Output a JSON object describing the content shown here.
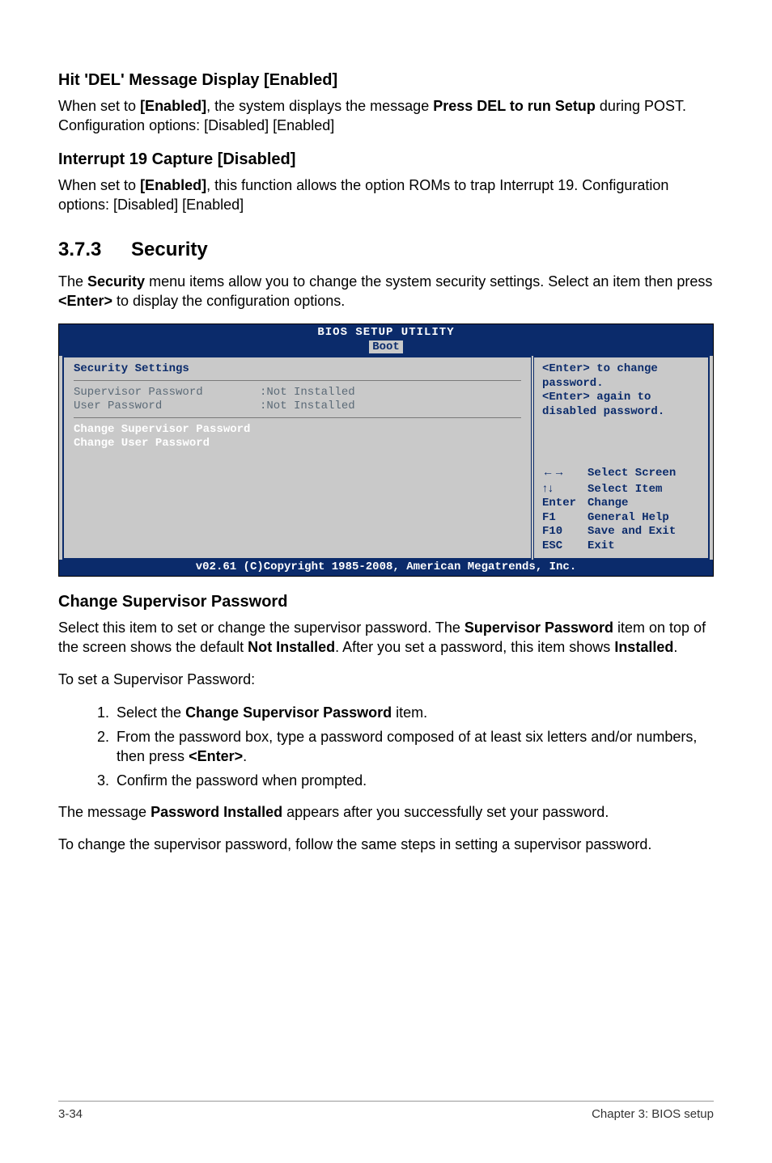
{
  "s1": {
    "heading": "Hit 'DEL' Message Display [Enabled]",
    "p_pre": "When set to ",
    "p_b1": "[Enabled]",
    "p_mid": ", the system displays the message ",
    "p_b2": "Press DEL to run Setup",
    "p_post": " during POST. Configuration options: [Disabled] [Enabled]"
  },
  "s2": {
    "heading": "Interrupt 19 Capture [Disabled]",
    "p_pre": "When set to ",
    "p_b1": "[Enabled]",
    "p_post": ", this function allows the option ROMs to trap Interrupt 19. Configuration options: [Disabled] [Enabled]"
  },
  "sec": {
    "num": "3.7.3",
    "title": "Security",
    "intro_pre": "The ",
    "intro_b1": "Security",
    "intro_mid": " menu items allow you to change the system security settings. Select an item then press ",
    "intro_b2": "<Enter>",
    "intro_post": " to display the configuration options."
  },
  "bios": {
    "title": "BIOS SETUP UTILITY",
    "tab": "Boot",
    "left_head": "Security Settings",
    "row1_lbl": "Supervisor Password",
    "row1_val": ":Not Installed",
    "row2_lbl": "User Password",
    "row2_val": ":Not Installed",
    "sel1": "Change Supervisor Password",
    "sel2": "Change User Password",
    "help1": "<Enter> to change password.",
    "help2": "<Enter> again to disabled password.",
    "k_arrows_lr": "←→",
    "k_arrows_ud": "↑↓",
    "k_enter": "Enter",
    "k_f1": "F1",
    "k_f10": "F10",
    "k_esc": "ESC",
    "v_select_screen": "Select Screen",
    "v_select_item": "Select Item",
    "v_change": "Change",
    "v_help": "General Help",
    "v_save": "Save and Exit",
    "v_exit": "Exit",
    "footer": "v02.61 (C)Copyright 1985-2008, American Megatrends, Inc."
  },
  "csp": {
    "heading": "Change Supervisor Password",
    "p1_pre": "Select this item to set or change the supervisor password. The ",
    "p1_b1": "Supervisor Password",
    "p1_mid": " item on top of the screen shows the default ",
    "p1_b2": "Not Installed",
    "p1_mid2": ". After you set a password, this item shows ",
    "p1_b3": "Installed",
    "p1_post": ".",
    "p2": "To set a Supervisor Password:",
    "li1_pre": "Select the ",
    "li1_b": "Change Supervisor Password",
    "li1_post": " item.",
    "li2_pre": "From the password box, type a password composed of at least six letters and/or numbers, then press ",
    "li2_b": "<Enter>",
    "li2_post": ".",
    "li3": "Confirm the password when prompted.",
    "p3_pre": "The message ",
    "p3_b": "Password Installed",
    "p3_post": " appears after you successfully set your password.",
    "p4": "To change the supervisor password, follow the same steps in setting a supervisor password."
  },
  "footer": {
    "left": "3-34",
    "right": "Chapter 3: BIOS setup"
  }
}
